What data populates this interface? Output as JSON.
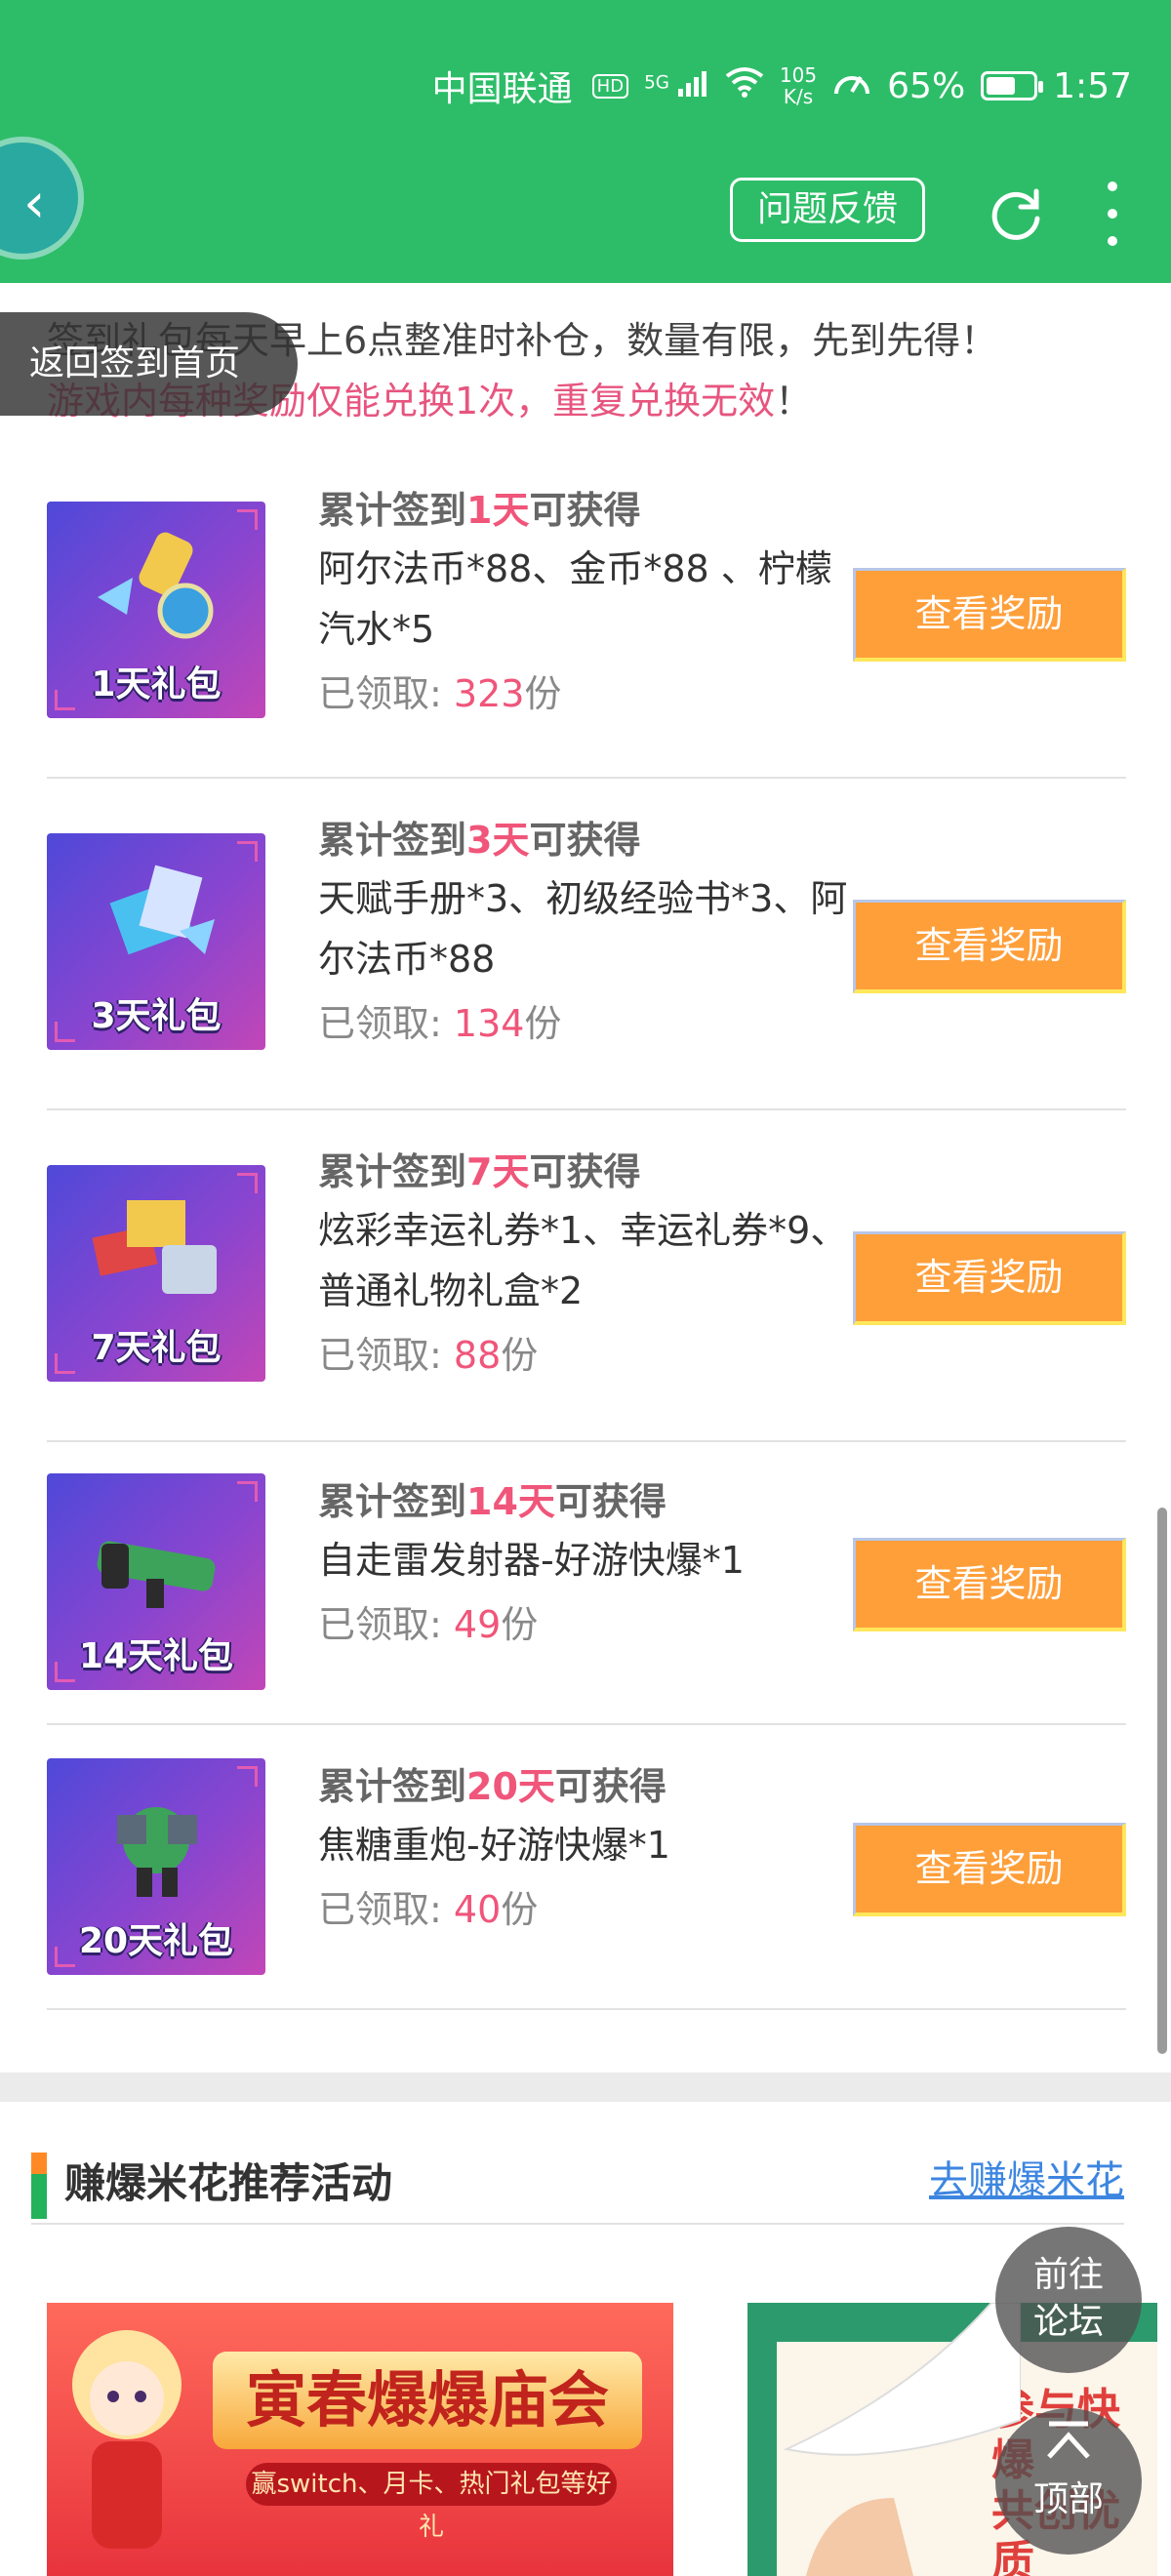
{
  "status": {
    "carrier": "中国联通",
    "hd": "HD",
    "signal": "5G",
    "speed_value": "105",
    "speed_unit": "K/s",
    "battery": "65%",
    "time": "1:57"
  },
  "header": {
    "feedback_label": "问题反馈"
  },
  "back_tooltip": "返回签到首页",
  "notice": {
    "line1": "签到礼包每天早上6点整准时补仓，数量有限，先到先得！",
    "line2": "游戏内每种奖励仅能兑换1次，重复兑换无效",
    "line2_end": "！"
  },
  "rewards": [
    {
      "gift_label": "1天礼包",
      "title_prefix": "累计签到",
      "days": "1天",
      "title_suffix": "可获得",
      "desc": "阿尔法币*88、金币*88 、柠檬汽水*5",
      "claimed_label": "已领取: ",
      "claimed_count": "323",
      "claimed_unit": "份",
      "button": "查看奖励"
    },
    {
      "gift_label": "3天礼包",
      "title_prefix": "累计签到",
      "days": "3天",
      "title_suffix": "可获得",
      "desc": "天赋手册*3、初级经验书*3、阿尔法币*88",
      "claimed_label": "已领取: ",
      "claimed_count": "134",
      "claimed_unit": "份",
      "button": "查看奖励"
    },
    {
      "gift_label": "7天礼包",
      "title_prefix": "累计签到",
      "days": "7天",
      "title_suffix": "可获得",
      "desc": "炫彩幸运礼券*1、幸运礼券*9、普通礼物礼盒*2",
      "claimed_label": "已领取: ",
      "claimed_count": "88",
      "claimed_unit": "份",
      "button": "查看奖励"
    },
    {
      "gift_label": "14天礼包",
      "title_prefix": "累计签到",
      "days": "14天",
      "title_suffix": "可获得",
      "desc": "自走雷发射器-好游快爆*1",
      "claimed_label": "已领取: ",
      "claimed_count": "49",
      "claimed_unit": "份",
      "button": "查看奖励"
    },
    {
      "gift_label": "20天礼包",
      "title_prefix": "累计签到",
      "days": "20天",
      "title_suffix": "可获得",
      "desc": "焦糖重炮-好游快爆*1",
      "claimed_label": "已领取: ",
      "claimed_count": "40",
      "claimed_unit": "份",
      "button": "查看奖励"
    }
  ],
  "section": {
    "title": "赚爆米花推荐活动",
    "link": "去赚爆米花"
  },
  "banners": {
    "b1_title": "寅春爆爆庙会",
    "b1_sub": "赢switch、月卡、热门礼包等好礼",
    "b2_text_line1": "参与快爆",
    "b2_text_line2": "共创优质"
  },
  "floating": {
    "forum_line1": "前往",
    "forum_line2": "论坛",
    "top_label": "顶部"
  }
}
